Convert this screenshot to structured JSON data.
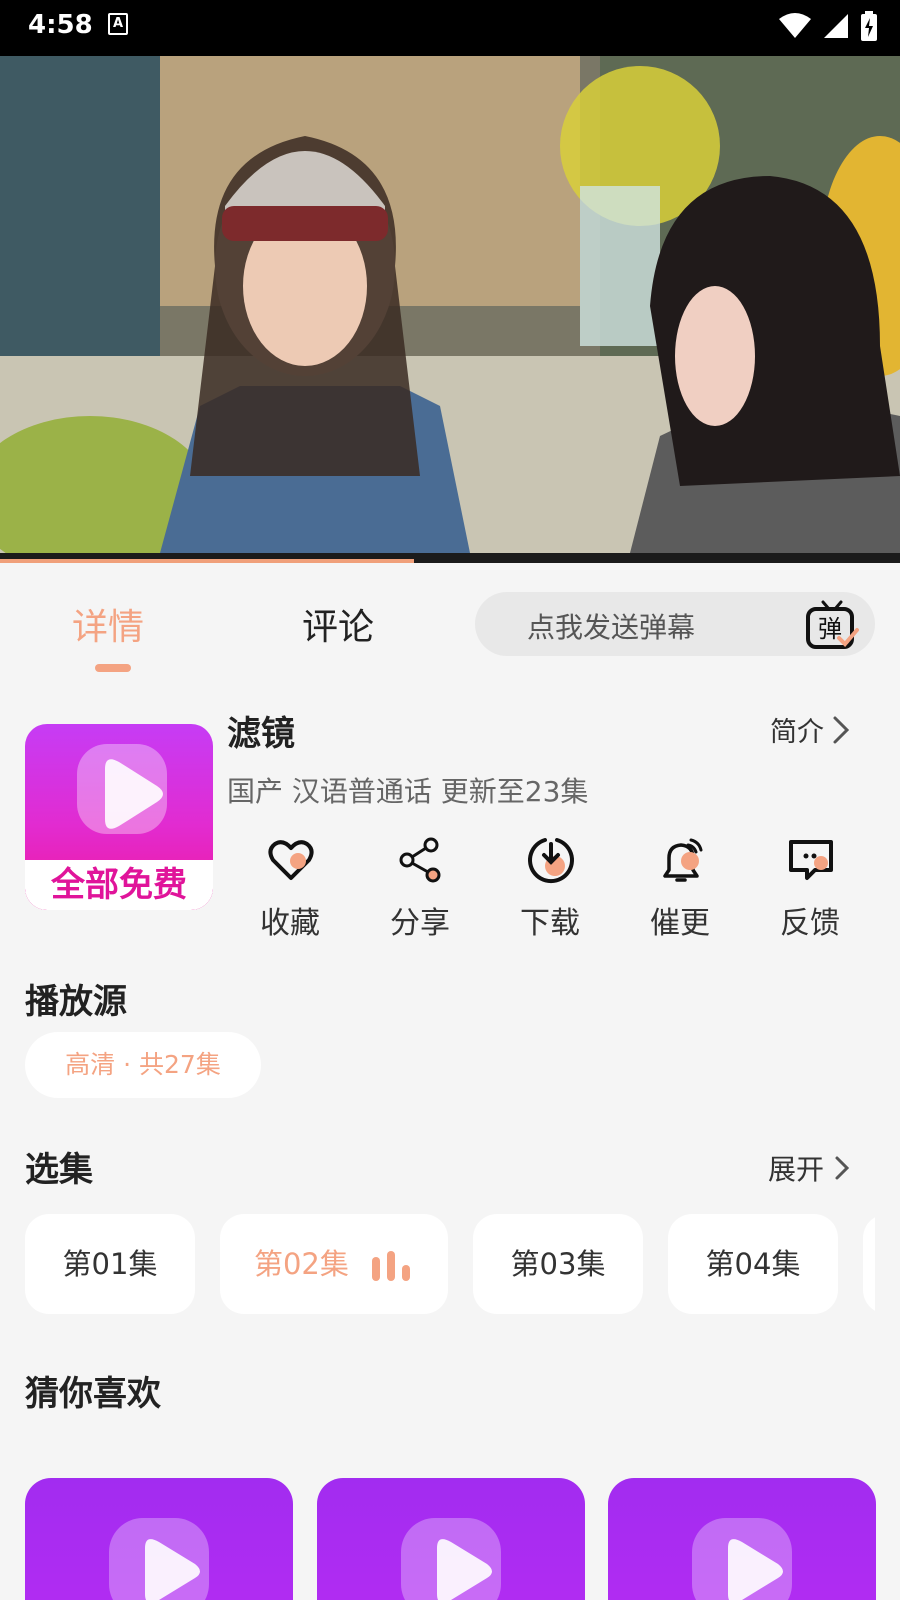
{
  "status_bar": {
    "time": "4:58",
    "notification_icon_letter": "A",
    "icons": [
      "wifi-icon",
      "signal-icon",
      "battery-icon"
    ]
  },
  "video": {
    "progress": 0.46,
    "colors": {
      "progress": "#f0a07a"
    }
  },
  "tabs": [
    {
      "label": "详情",
      "active": true
    },
    {
      "label": "评论",
      "active": false
    }
  ],
  "danmu": {
    "placeholder": "点我发送弹幕",
    "icon_glyph": "弹"
  },
  "show": {
    "poster_badge": "全部免费",
    "title": "滤镜",
    "intro_label": "简介",
    "meta": "国产 汉语普通话 更新至23集"
  },
  "actions": [
    {
      "label": "收藏",
      "icon": "heart-icon"
    },
    {
      "label": "分享",
      "icon": "share-icon"
    },
    {
      "label": "下载",
      "icon": "download-icon"
    },
    {
      "label": "催更",
      "icon": "bell-icon"
    },
    {
      "label": "反馈",
      "icon": "feedback-icon"
    }
  ],
  "sources": {
    "title": "播放源",
    "selected": "高清 · 共27集"
  },
  "episodes": {
    "title": "选集",
    "expand_label": "展开",
    "items": [
      {
        "label": "第01集",
        "active": false
      },
      {
        "label": "第02集",
        "active": true
      },
      {
        "label": "第03集",
        "active": false
      },
      {
        "label": "第04集",
        "active": false
      }
    ]
  },
  "recommend": {
    "title": "猜你喜欢"
  },
  "colors": {
    "accent": "#f4a382",
    "background": "#f5f5f5"
  }
}
